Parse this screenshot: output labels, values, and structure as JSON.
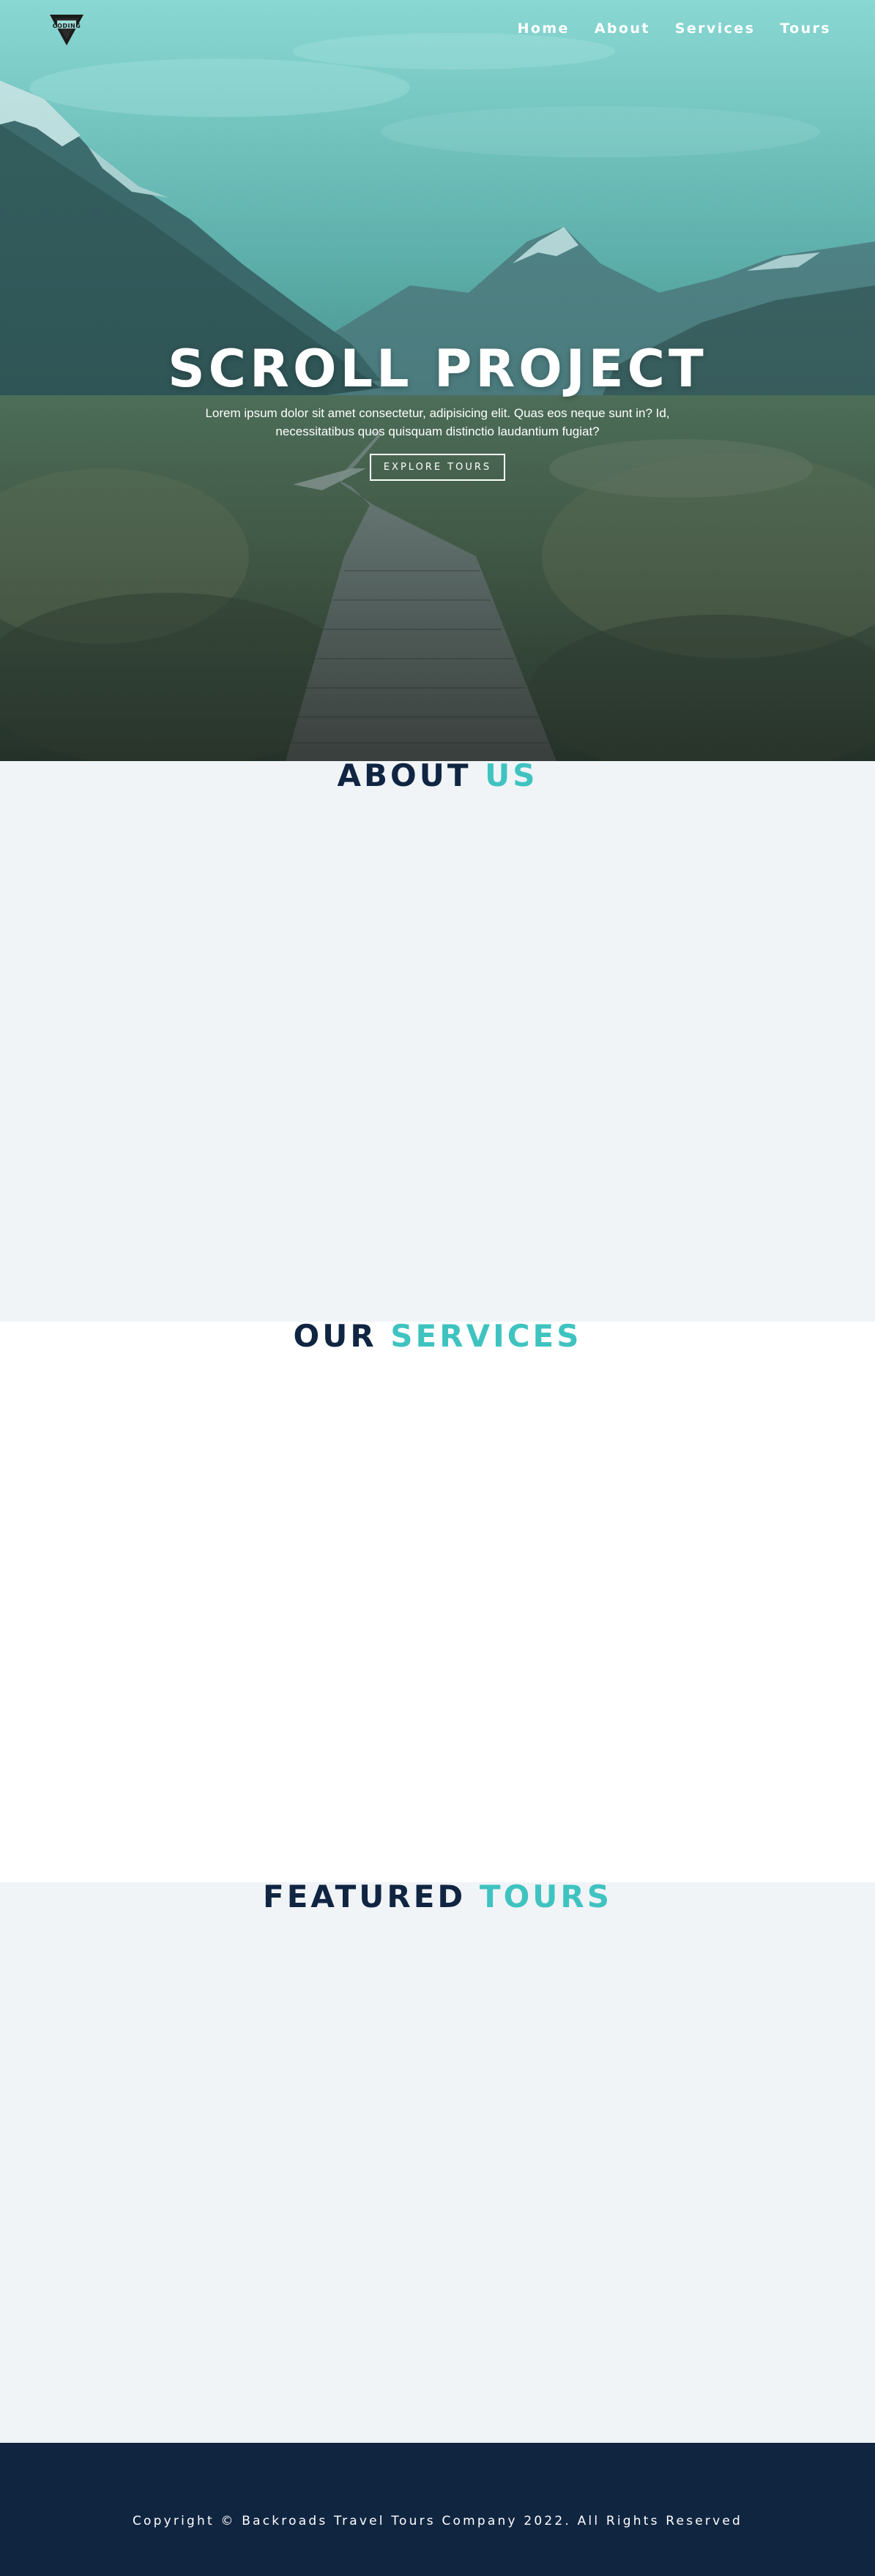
{
  "brand": {
    "logo_text": "CODING",
    "logo_alt": "Backroads logo"
  },
  "nav": {
    "items": [
      {
        "label": "Home"
      },
      {
        "label": "About"
      },
      {
        "label": "Services"
      },
      {
        "label": "Tours"
      }
    ]
  },
  "hero": {
    "title": "SCROLL PROJECT",
    "text": "Lorem ipsum dolor sit amet consectetur, adipisicing elit. Quas eos neque sunt in? Id, necessitatibus quos quisquam distinctio laudantium fugiat?",
    "button_label": "EXPLORE TOURS"
  },
  "sections": {
    "about": {
      "title_main": "ABOUT",
      "title_accent": "US"
    },
    "services": {
      "title_main": "OUR",
      "title_accent": "SERVICES"
    },
    "tours": {
      "title_main": "FEATURED",
      "title_accent": "TOURS"
    }
  },
  "footer": {
    "copyright": "Copyright © Backroads Travel Tours Company 2022. All Rights Reserved"
  },
  "colors": {
    "primary_dark": "#102542",
    "accent": "#3fc3c0",
    "light_bg": "#f0f4f7",
    "footer_bg": "#102540",
    "hero_tint": "#3fc3c0"
  },
  "icons": {
    "logo": "coding-logo-triangle-icon"
  }
}
